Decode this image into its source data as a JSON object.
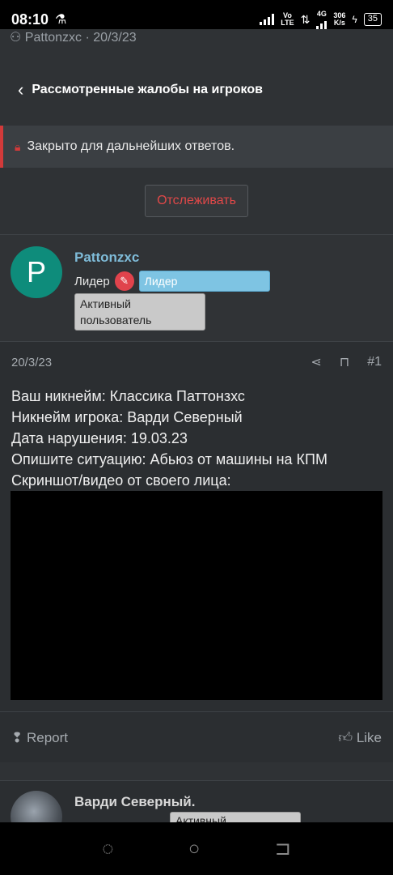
{
  "statusbar": {
    "time": "08:10",
    "net_top": "Vo",
    "net_bottom": "LTE",
    "gen": "4G",
    "speed_top": "306",
    "speed_bottom": "K/s",
    "battery": "35"
  },
  "top_partial": {
    "text": "Pattonzxc · 20/3/23"
  },
  "breadcrumb": {
    "title": "Рассмотренные жалобы на игроков"
  },
  "lock_notice": {
    "text": "Закрыто для дальнейших ответов."
  },
  "watch_button": {
    "label": "Отслеживать"
  },
  "post": {
    "avatar_letter": "P",
    "username": "Pattonzxc",
    "role": "Лидер",
    "banner_blue": "Лидер",
    "banner_grey": "Активный пользователь",
    "date": "20/3/23",
    "number": "#1",
    "lines": [
      "Ваш никнейм: Классика Паттонзхс",
      "Никнейм игрока: Варди Северный",
      "Дата нарушения: 19.03.23",
      "Опишите ситуацию: Абьюз от машины на КПМ",
      "Скриншот/видео от своего лица:"
    ],
    "report_label": "Report",
    "like_label": "Like"
  },
  "next_post": {
    "username": "Варди Северный.",
    "banner": "Активный"
  },
  "colors": {
    "accent_red": "#d23a3a",
    "username_blue": "#7fbcd9",
    "avatar_teal": "#0e8c7b"
  }
}
